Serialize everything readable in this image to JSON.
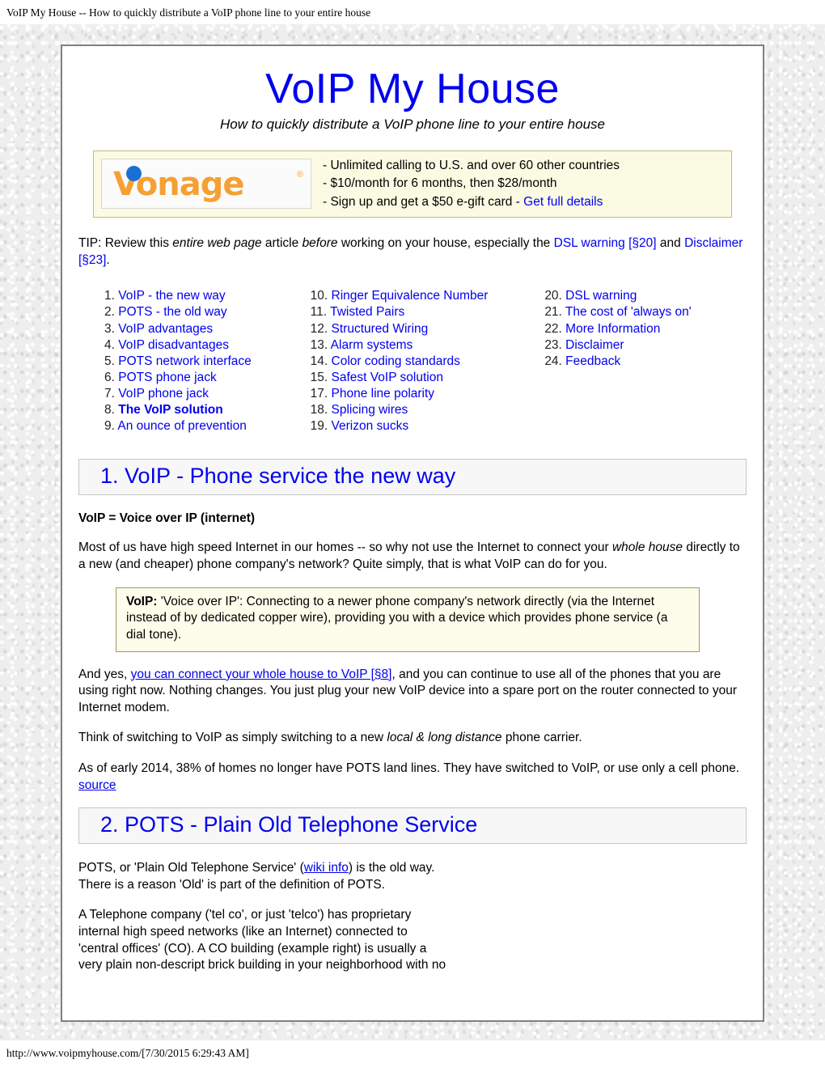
{
  "browser": {
    "print_header": "VoIP My House -- How to quickly distribute a VoIP phone line to your entire house",
    "print_footer": "http://www.voipmyhouse.com/[7/30/2015 6:29:43 AM]"
  },
  "colors": {
    "link": "#0000ee",
    "heading_text": "#0000ee",
    "heading_bar_bg": "#f7f7f7",
    "ad_bg": "#fbfbe3",
    "def_box_bg": "#fdfdec",
    "vonage_orange": "#f5a033",
    "vonage_blue": "#1a6fd4",
    "page_bg": "#e9e9e9",
    "card_border": "#808080"
  },
  "header": {
    "title": "VoIP My House",
    "subtitle": "How to quickly distribute a VoIP phone line to your entire house"
  },
  "ad": {
    "logo_word": "Vonage",
    "logo_reg": "®",
    "line1": "- Unlimited calling to U.S. and over 60 other countries",
    "line2": "- $10/month for 6 months, then $28/month",
    "line3_pre": "- Sign up and get a $50 e-gift card - ",
    "line3_link": "Get full details"
  },
  "tip": {
    "p1": "TIP: Review this ",
    "i1": "entire web page",
    "p2": " article ",
    "i2": "before",
    "p3": " working on your house, especially the ",
    "link1": "DSL warning [§20]",
    "p4": " and ",
    "link2": "Disclaimer [§23]",
    "p5": "."
  },
  "toc": {
    "col1": [
      {
        "num": "1.",
        "label": "VoIP - the new way",
        "bold": false
      },
      {
        "num": "2.",
        "label": "POTS - the old way",
        "bold": false
      },
      {
        "num": "3.",
        "label": "VoIP advantages",
        "bold": false
      },
      {
        "num": "4.",
        "label": "VoIP disadvantages",
        "bold": false
      },
      {
        "num": "5.",
        "label": "POTS network interface",
        "bold": false
      },
      {
        "num": "6.",
        "label": "POTS phone jack",
        "bold": false
      },
      {
        "num": "7.",
        "label": "VoIP phone jack",
        "bold": false
      },
      {
        "num": "8.",
        "label": "The VoIP solution",
        "bold": true
      },
      {
        "num": "9.",
        "label": "An ounce of prevention",
        "bold": false
      }
    ],
    "col2": [
      {
        "num": "10.",
        "label": "Ringer Equivalence Number",
        "bold": false
      },
      {
        "num": "11.",
        "label": "Twisted Pairs",
        "bold": false
      },
      {
        "num": "12.",
        "label": "Structured Wiring",
        "bold": false
      },
      {
        "num": "13.",
        "label": "Alarm systems",
        "bold": false
      },
      {
        "num": "14.",
        "label": "Color coding standards",
        "bold": false
      },
      {
        "num": "15.",
        "label": "Safest VoIP solution",
        "bold": false
      },
      {
        "num": "17.",
        "label": "Phone line polarity",
        "bold": false
      },
      {
        "num": "18.",
        "label": "Splicing wires",
        "bold": false
      },
      {
        "num": "19.",
        "label": "Verizon sucks",
        "bold": false
      }
    ],
    "col3": [
      {
        "num": "20.",
        "label": "DSL warning",
        "bold": false
      },
      {
        "num": "21.",
        "label": "The cost of 'always on'",
        "bold": false
      },
      {
        "num": "22.",
        "label": "More Information",
        "bold": false
      },
      {
        "num": "23.",
        "label": "Disclaimer",
        "bold": false
      },
      {
        "num": "24.",
        "label": "Feedback",
        "bold": false
      }
    ]
  },
  "section1": {
    "heading": "1. VoIP - Phone service the new way",
    "subhead": "VoIP = Voice over IP (internet)",
    "p1_a": "Most of us have high speed Internet in our homes -- so why not use the Internet to connect your ",
    "p1_i": "whole house",
    "p1_b": " directly to a new (and cheaper) phone company's network? Quite simply, that is what VoIP can do for you.",
    "def_label": "VoIP:",
    "def_text": " 'Voice over IP': Connecting to a newer phone company's network directly (via the Internet instead of by dedicated copper wire), providing you with a device which provides phone service (a dial tone).",
    "p2_a": "And yes, ",
    "p2_link": "you can connect your whole house to VoIP [§8]",
    "p2_b": ", and you can continue to use all of the phones that you are using right now. Nothing changes. You just plug your new VoIP device into a spare port on the router connected to your Internet modem.",
    "p3_a": "Think of switching to VoIP as simply switching to a new ",
    "p3_i": "local & long distance",
    "p3_b": " phone carrier.",
    "p4_a": "As of early 2014, 38% of homes no longer have POTS land lines. They have switched to VoIP, or use only a cell phone. ",
    "p4_link": "source"
  },
  "section2": {
    "heading": "2. POTS - Plain Old Telephone Service",
    "p1_a": "POTS, or 'Plain Old Telephone Service' (",
    "p1_link": "wiki info",
    "p1_b": ") is the old way.\nThere is a reason 'Old' is part of the definition of POTS.",
    "p2": "A Telephone company ('tel co', or just 'telco') has proprietary\ninternal high speed networks (like an Internet) connected to\n'central offices' (CO). A CO building (example right) is usually a\nvery plain non-descript brick building in your neighborhood with no"
  }
}
